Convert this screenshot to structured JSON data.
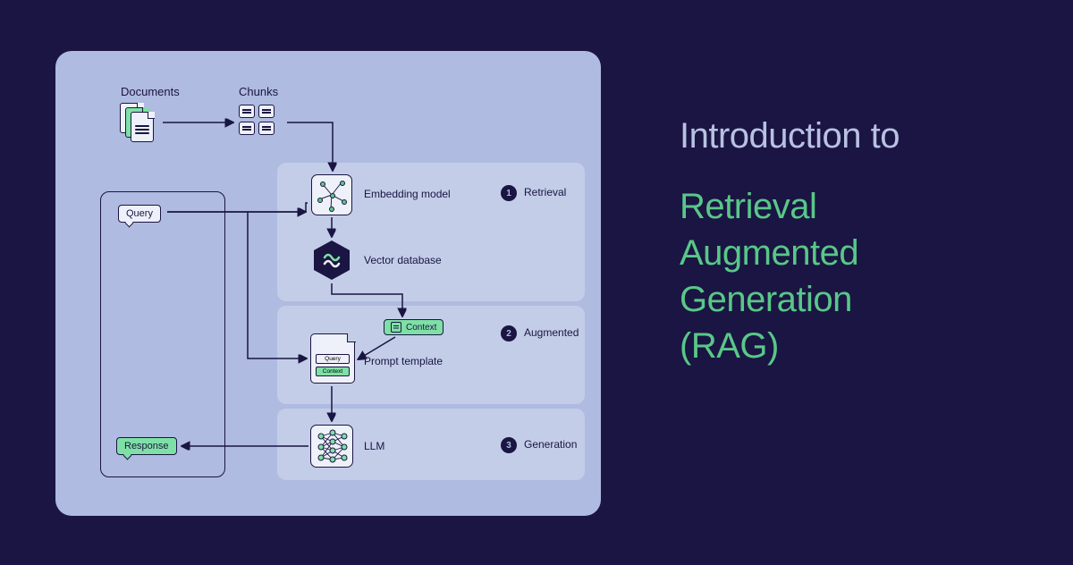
{
  "title": {
    "line1": "Introduction to",
    "line2": "Retrieval Augmented Generation (RAG)"
  },
  "diagram": {
    "documents_label": "Documents",
    "chunks_label": "Chunks",
    "query_label": "Query",
    "response_label": "Response",
    "context_label": "Context",
    "stages": [
      {
        "num": "1",
        "name": "Retrieval"
      },
      {
        "num": "2",
        "name": "Augmented"
      },
      {
        "num": "3",
        "name": "Generation"
      }
    ],
    "nodes": {
      "embedding": "Embedding model",
      "vectordb": "Vector database",
      "prompt": "Prompt template",
      "llm": "LLM",
      "prompt_inner_query": "Query",
      "prompt_inner_context": "Context"
    }
  },
  "colors": {
    "background": "#1a1543",
    "panel": "#afbbe0",
    "stage": "#c3cde8",
    "accent_green": "#59c788",
    "light_green": "#7fe0a6",
    "node_bg": "#eef1f9",
    "text_light": "#b9c1e3"
  }
}
